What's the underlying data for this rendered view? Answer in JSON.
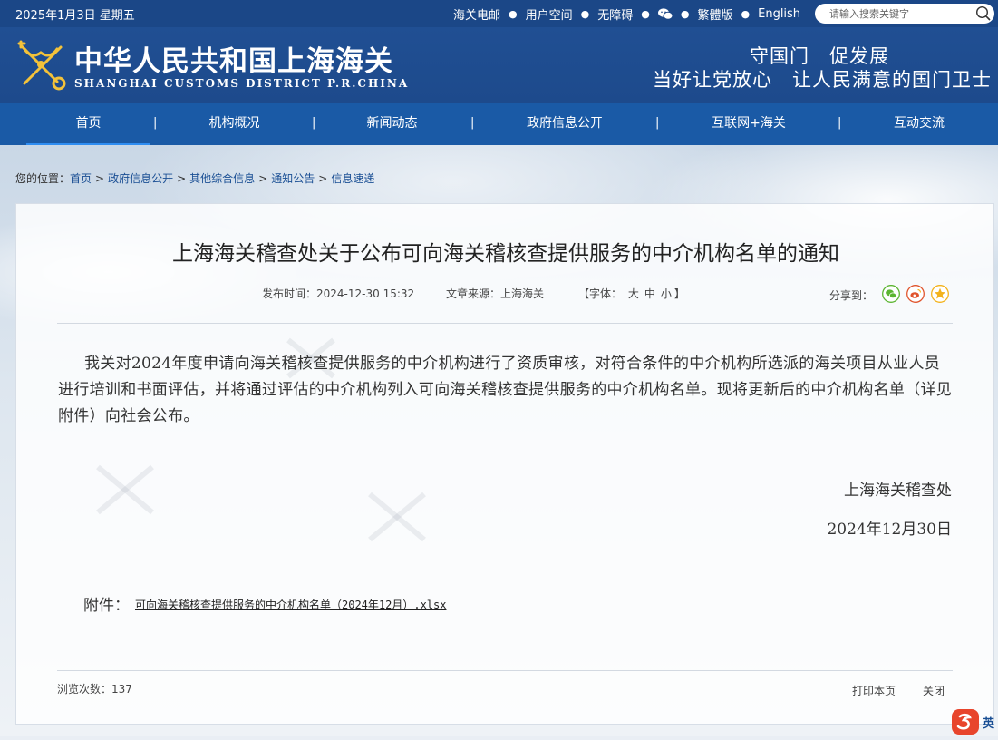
{
  "topbar": {
    "date": "2025年1月3日 星期五",
    "links": [
      "海关电邮",
      "用户空间",
      "无障碍",
      "繁體版",
      "English"
    ],
    "search_placeholder": "请输入搜索关键字"
  },
  "header": {
    "title_cn": "中华人民共和国上海海关",
    "title_en": "SHANGHAI CUSTOMS DISTRICT P.R.CHINA",
    "slogan_line1": "守国门　促发展",
    "slogan_line2": "当好让党放心　让人民满意的国门卫士"
  },
  "nav": {
    "items": [
      "首页",
      "机构概况",
      "新闻动态",
      "政府信息公开",
      "互联网+海关",
      "互动交流"
    ],
    "separator": "|",
    "active": "首页"
  },
  "breadcrumb": {
    "prefix": "您的位置：",
    "items": [
      "首页",
      "政府信息公开",
      "其他综合信息",
      "通知公告",
      "信息速递"
    ],
    "separator": ">"
  },
  "article": {
    "title": "上海海关稽查处关于公布可向海关稽核查提供服务的中介机构名单的通知",
    "publish_label": "发布时间：",
    "publish_time": "2024-12-30 15:32",
    "source_label": "文章来源：",
    "source": "上海海关",
    "font_label_open": "【字体：",
    "font_sizes": [
      "大",
      "中",
      "小"
    ],
    "font_label_close": "】",
    "share_label": "分享到：",
    "body": "我关对2024年度申请向海关稽核查提供服务的中介机构进行了资质审核，对符合条件的中介机构所选派的海关项目从业人员进行培训和书面评估，并将通过评估的中介机构列入可向海关稽核查提供服务的中介机构名单。现将更新后的中介机构名单（详见附件）向社会公布。",
    "sign_org": "上海海关稽查处",
    "sign_date": "2024年12月30日",
    "attachment_label": "附件：",
    "attachment_name": "可向海关稽核查提供服务的中介机构名单（2024年12月）.xlsx",
    "views_label": "浏览次数：",
    "views": "137",
    "print_label": "打印本页",
    "close_label": "关闭"
  },
  "ime": {
    "label": "英"
  },
  "colors": {
    "topbar": "#1b4787",
    "header": "#1f4d90",
    "nav": "#1a5aa6",
    "active_underline": "#2e8df2",
    "wechat": "#5cb531",
    "weibo": "#e0542c",
    "qzone": "#f3b21b"
  }
}
